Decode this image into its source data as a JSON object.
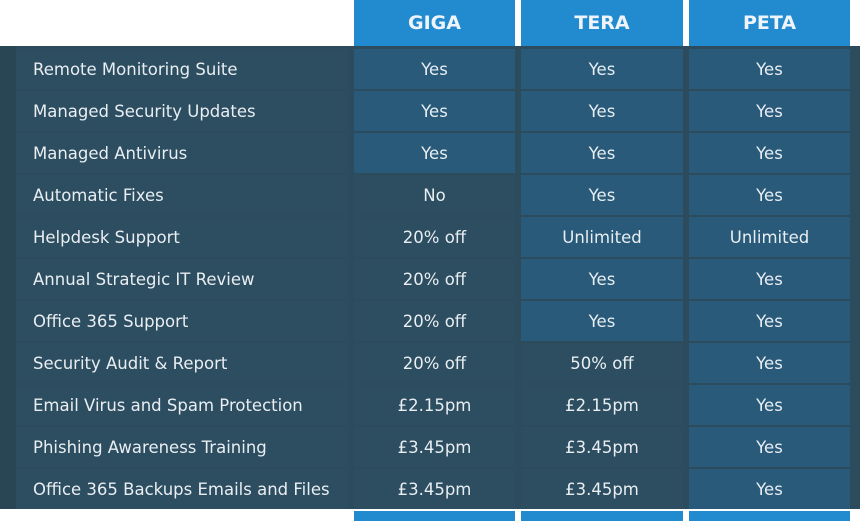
{
  "columns": [
    "GIGA",
    "TERA",
    "PETA"
  ],
  "rows": [
    {
      "feature": "Remote Monitoring Suite",
      "values": [
        "Yes",
        "Yes",
        "Yes"
      ],
      "highlight": [
        true,
        true,
        true
      ]
    },
    {
      "feature": "Managed Security Updates",
      "values": [
        "Yes",
        "Yes",
        "Yes"
      ],
      "highlight": [
        true,
        true,
        true
      ]
    },
    {
      "feature": "Managed Antivirus",
      "values": [
        "Yes",
        "Yes",
        "Yes"
      ],
      "highlight": [
        true,
        true,
        true
      ]
    },
    {
      "feature": "Automatic Fixes",
      "values": [
        "No",
        "Yes",
        "Yes"
      ],
      "highlight": [
        false,
        true,
        true
      ]
    },
    {
      "feature": "Helpdesk Support",
      "values": [
        "20% off",
        "Unlimited",
        "Unlimited"
      ],
      "highlight": [
        false,
        true,
        true
      ]
    },
    {
      "feature": "Annual Strategic IT Review",
      "values": [
        "20% off",
        "Yes",
        "Yes"
      ],
      "highlight": [
        false,
        true,
        true
      ]
    },
    {
      "feature": "Office 365 Support",
      "values": [
        "20% off",
        "Yes",
        "Yes"
      ],
      "highlight": [
        false,
        true,
        true
      ]
    },
    {
      "feature": "Security Audit & Report",
      "values": [
        "20% off",
        "50% off",
        "Yes"
      ],
      "highlight": [
        false,
        false,
        true
      ]
    },
    {
      "feature": "Email Virus and Spam Protection",
      "values": [
        "£2.15pm",
        "£2.15pm",
        "Yes"
      ],
      "highlight": [
        false,
        false,
        true
      ]
    },
    {
      "feature": "Phishing Awareness Training",
      "values": [
        "£3.45pm",
        "£3.45pm",
        "Yes"
      ],
      "highlight": [
        false,
        false,
        true
      ]
    },
    {
      "feature": "Office 365 Backups Emails and Files",
      "values": [
        "£3.45pm",
        "£3.45pm",
        "Yes"
      ],
      "highlight": [
        false,
        false,
        true
      ]
    }
  ],
  "colors": {
    "header": "#228bd0",
    "included": "#295a7a",
    "not_included": "#2d4d60",
    "frame": "#2c4c5e"
  }
}
